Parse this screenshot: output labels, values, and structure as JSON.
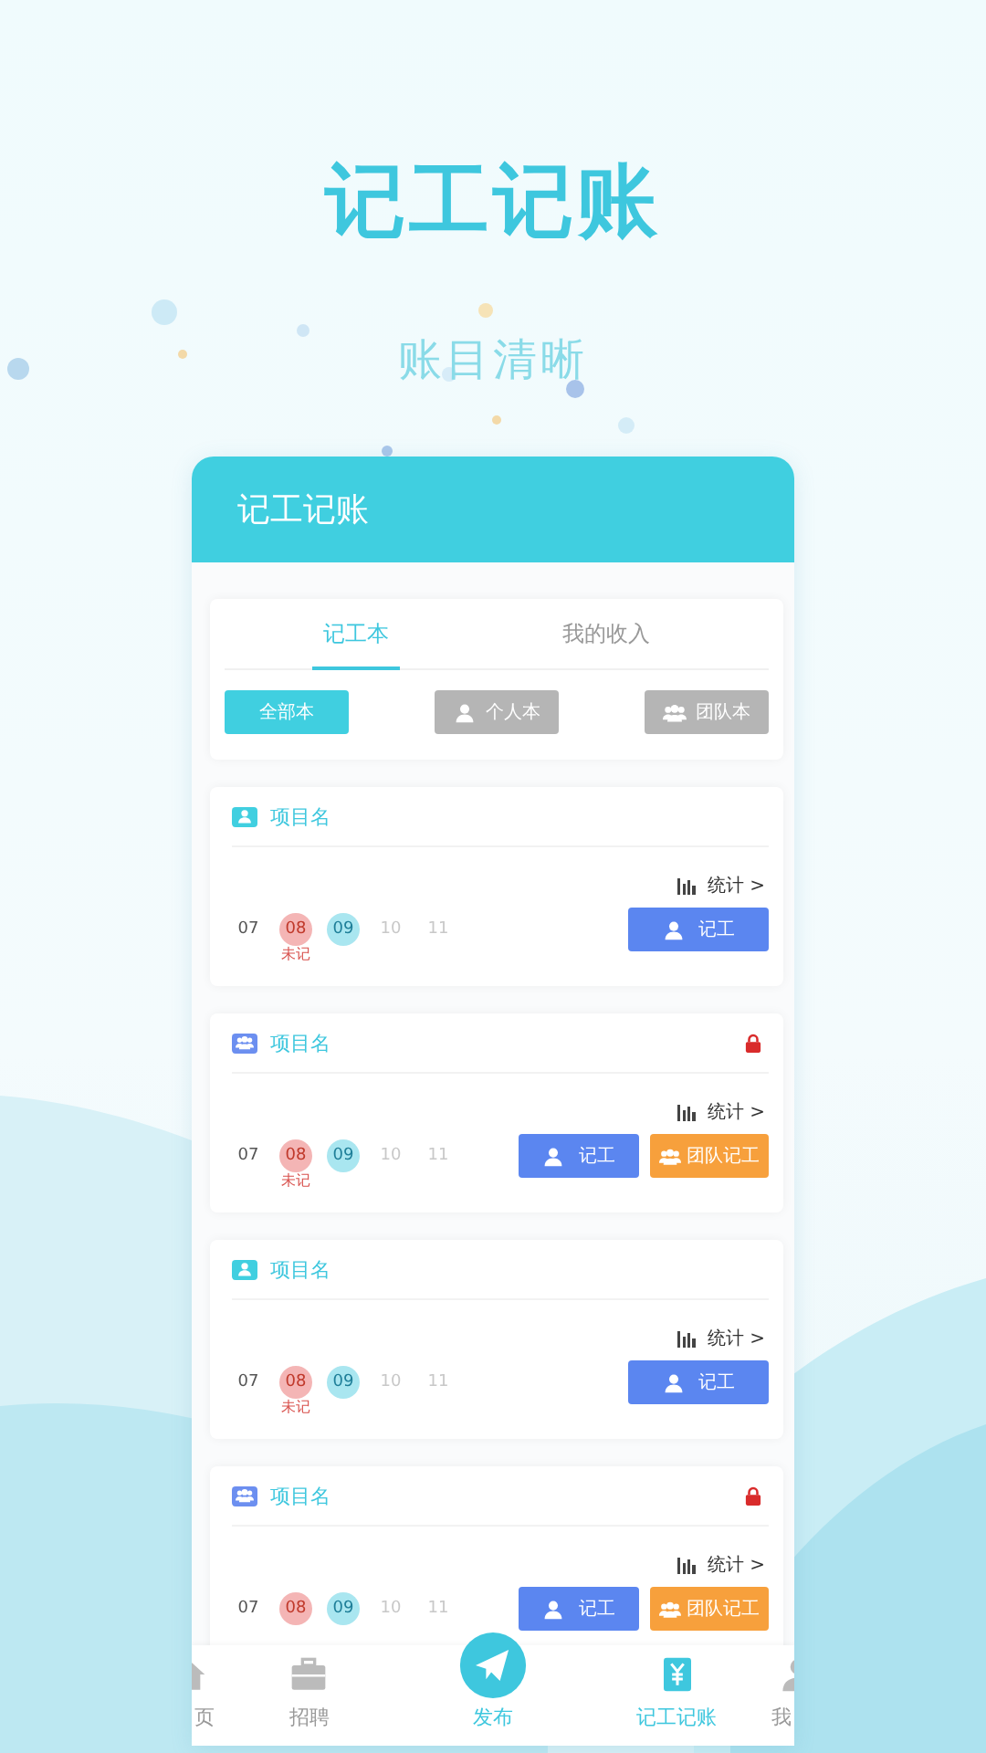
{
  "headline": "记工记账",
  "subheadline": "账目清晰",
  "app": {
    "title": "记工记账",
    "tabs": [
      {
        "label": "记工本",
        "selected": true
      },
      {
        "label": "我的收入",
        "selected": false
      }
    ],
    "filters": [
      {
        "label": "全部本",
        "kind": "all",
        "selected": true
      },
      {
        "label": "个人本",
        "kind": "personal",
        "selected": false
      },
      {
        "label": "团队本",
        "kind": "team",
        "selected": false
      }
    ],
    "projects": [
      {
        "kind": "personal",
        "name": "项目名",
        "locked": false,
        "stats": "统计 >",
        "dates": [
          {
            "day": "07",
            "kind": "plain"
          },
          {
            "day": "08",
            "kind": "missed",
            "note": "未记"
          },
          {
            "day": "09",
            "kind": "today"
          },
          {
            "day": "10",
            "kind": "future"
          },
          {
            "day": "11",
            "kind": "future"
          }
        ],
        "buttons": [
          {
            "label": "记工",
            "kind": "personal"
          }
        ]
      },
      {
        "kind": "team",
        "name": "项目名",
        "locked": true,
        "stats": "统计 >",
        "dates": [
          {
            "day": "07",
            "kind": "plain"
          },
          {
            "day": "08",
            "kind": "missed",
            "note": "未记"
          },
          {
            "day": "09",
            "kind": "today"
          },
          {
            "day": "10",
            "kind": "future"
          },
          {
            "day": "11",
            "kind": "future"
          }
        ],
        "buttons": [
          {
            "label": "记工",
            "kind": "personal"
          },
          {
            "label": "团队记工",
            "kind": "team"
          }
        ]
      },
      {
        "kind": "personal",
        "name": "项目名",
        "locked": false,
        "stats": "统计 >",
        "dates": [
          {
            "day": "07",
            "kind": "plain"
          },
          {
            "day": "08",
            "kind": "missed",
            "note": "未记"
          },
          {
            "day": "09",
            "kind": "today"
          },
          {
            "day": "10",
            "kind": "future"
          },
          {
            "day": "11",
            "kind": "future"
          }
        ],
        "buttons": [
          {
            "label": "记工",
            "kind": "personal"
          }
        ]
      },
      {
        "kind": "team",
        "name": "项目名",
        "locked": true,
        "stats": "统计 >",
        "dates": [
          {
            "day": "07",
            "kind": "plain"
          },
          {
            "day": "08",
            "kind": "missed"
          },
          {
            "day": "09",
            "kind": "today"
          },
          {
            "day": "10",
            "kind": "future"
          },
          {
            "day": "11",
            "kind": "future"
          }
        ],
        "buttons": [
          {
            "label": "记工",
            "kind": "personal"
          },
          {
            "label": "团队记工",
            "kind": "team"
          }
        ]
      }
    ],
    "nav": [
      {
        "label": "页",
        "kind": "home",
        "selected": false
      },
      {
        "label": "招聘",
        "kind": "jobs",
        "selected": false
      },
      {
        "label": "发布",
        "kind": "publish",
        "selected": false
      },
      {
        "label": "记工记账",
        "kind": "ledger",
        "selected": true
      },
      {
        "label": "我",
        "kind": "me",
        "selected": false
      }
    ]
  }
}
